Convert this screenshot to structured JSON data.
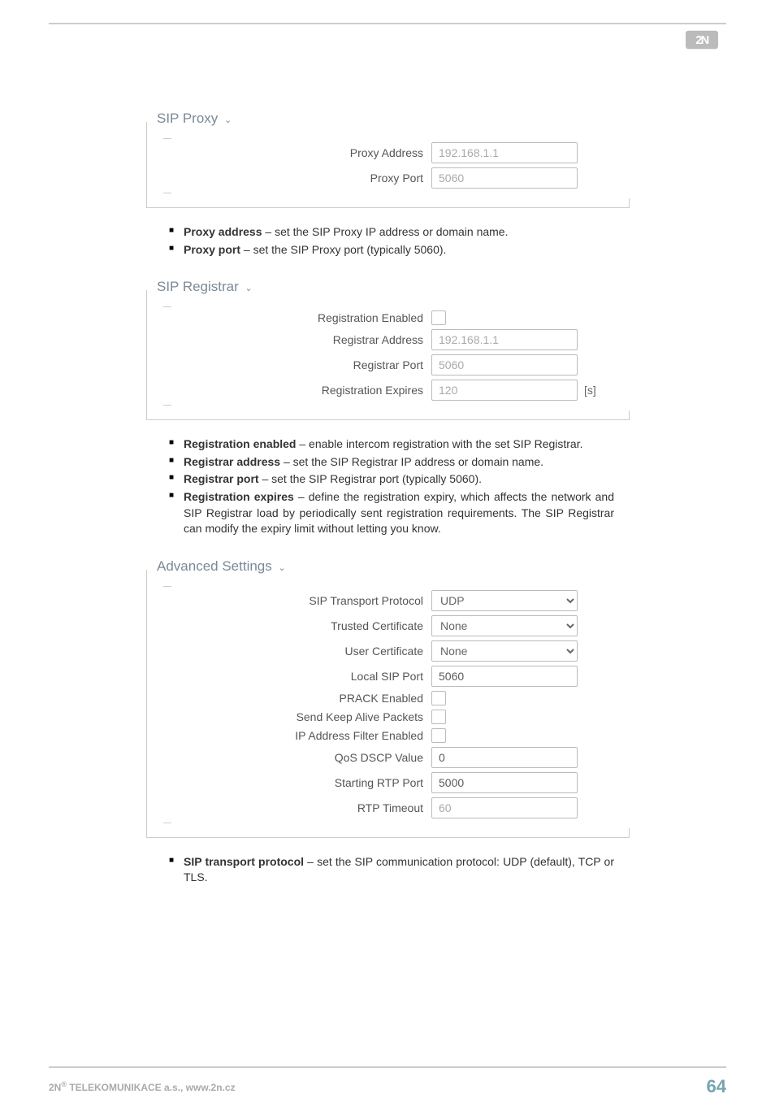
{
  "logo": "2N",
  "sections": {
    "sip_proxy": {
      "title": "SIP Proxy",
      "rows": {
        "proxy_address": {
          "label": "Proxy Address",
          "value": "192.168.1.1"
        },
        "proxy_port": {
          "label": "Proxy Port",
          "value": "5060"
        }
      }
    },
    "sip_registrar": {
      "title": "SIP Registrar",
      "rows": {
        "registration_enabled": {
          "label": "Registration Enabled"
        },
        "registrar_address": {
          "label": "Registrar Address",
          "value": "192.168.1.1"
        },
        "registrar_port": {
          "label": "Registrar Port",
          "value": "5060"
        },
        "registration_expires": {
          "label": "Registration Expires",
          "value": "120",
          "unit": "[s]"
        }
      }
    },
    "advanced": {
      "title": "Advanced Settings",
      "rows": {
        "sip_transport": {
          "label": "SIP Transport Protocol",
          "value": "UDP"
        },
        "trusted_cert": {
          "label": "Trusted Certificate",
          "value": "None"
        },
        "user_cert": {
          "label": "User Certificate",
          "value": "None"
        },
        "local_sip_port": {
          "label": "Local SIP Port",
          "value": "5060"
        },
        "prack_enabled": {
          "label": "PRACK Enabled"
        },
        "keep_alive": {
          "label": "Send Keep Alive Packets"
        },
        "ip_filter": {
          "label": "IP Address Filter Enabled"
        },
        "qos_dscp": {
          "label": "QoS DSCP Value",
          "value": "0"
        },
        "starting_rtp": {
          "label": "Starting RTP Port",
          "value": "5000"
        },
        "rtp_timeout": {
          "label": "RTP Timeout",
          "value": "60"
        }
      }
    }
  },
  "descriptions": {
    "proxy": [
      {
        "bold": "Proxy address",
        "text": " – set the SIP Proxy IP address or domain name."
      },
      {
        "bold": "Proxy port",
        "text": " – set the SIP Proxy port (typically 5060)."
      }
    ],
    "registrar": [
      {
        "bold": "Registration enabled",
        "text": " – enable intercom registration with the set SIP Registrar."
      },
      {
        "bold": "Registrar address",
        "text": " – set the SIP Registrar IP address or domain name."
      },
      {
        "bold": "Registrar port",
        "text": " – set the SIP Registrar port (typically 5060)."
      },
      {
        "bold": "Registration expires",
        "text": " – define the registration expiry, which affects the network and SIP Registrar load by periodically sent registration requirements. The SIP Registrar can modify the expiry limit without letting you know."
      }
    ],
    "advanced": [
      {
        "bold": "SIP transport protocol",
        "text": " – set the SIP communication protocol: UDP (default), TCP or TLS."
      }
    ]
  },
  "footer": {
    "left_prefix": "2N",
    "left_suffix": " TELEKOMUNIKACE a.s., www.2n.cz",
    "page": "64"
  }
}
